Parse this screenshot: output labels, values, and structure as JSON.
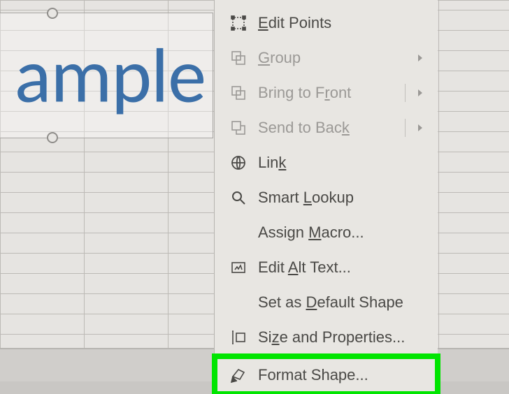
{
  "textbox": {
    "text": "ample"
  },
  "menu": {
    "edit_points": "Edit Points",
    "group": "Group",
    "bring_to_front": "Bring to Front",
    "send_to_back": "Send to Back",
    "link": "Link",
    "smart_lookup": "Smart Lookup",
    "assign_macro": "Assign Macro...",
    "edit_alt_text": "Edit Alt Text...",
    "set_default_shape": "Set as Default Shape",
    "size_properties": "Size and Properties...",
    "format_shape": "Format Shape..."
  },
  "underline_index": {
    "edit_points": 0,
    "group": 0,
    "bring_to_front": 10,
    "send_to_back": 11,
    "link": 3,
    "smart_lookup": 6,
    "assign_macro": 7,
    "edit_alt_text": 5,
    "set_default_shape": 7,
    "size_properties": 2
  }
}
